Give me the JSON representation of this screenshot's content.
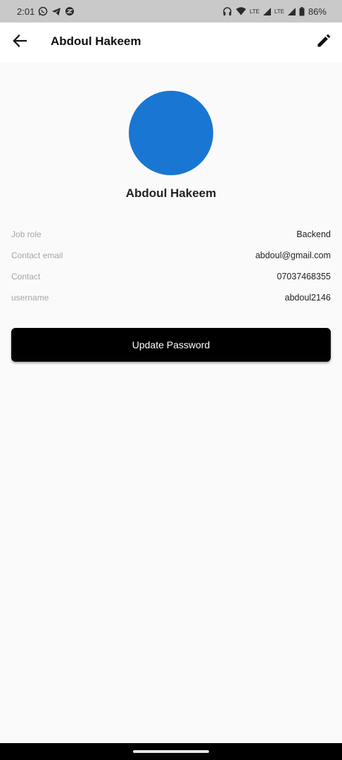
{
  "status_bar": {
    "time": "2:01",
    "lte_1": "LTE",
    "lte_2": "LTE",
    "battery_percent": "86%",
    "icons": [
      "whatsapp-icon",
      "telegram-icon",
      "app-notification-icon",
      "headphones-icon",
      "wifi-icon",
      "signal-icon",
      "battery-icon"
    ]
  },
  "app_bar": {
    "title": "Abdoul Hakeem",
    "back_icon": "arrow-back-icon",
    "edit_icon": "pencil-edit-icon"
  },
  "profile": {
    "avatar_color": "#1976d2",
    "name": "Abdoul Hakeem",
    "details": [
      {
        "label": "Job role",
        "value": "Backend"
      },
      {
        "label": "Contact email",
        "value": "abdoul@gmail.com"
      },
      {
        "label": "Contact",
        "value": "07037468355"
      },
      {
        "label": "username",
        "value": "abdoul2146"
      }
    ]
  },
  "actions": {
    "update_password_label": "Update Password"
  }
}
